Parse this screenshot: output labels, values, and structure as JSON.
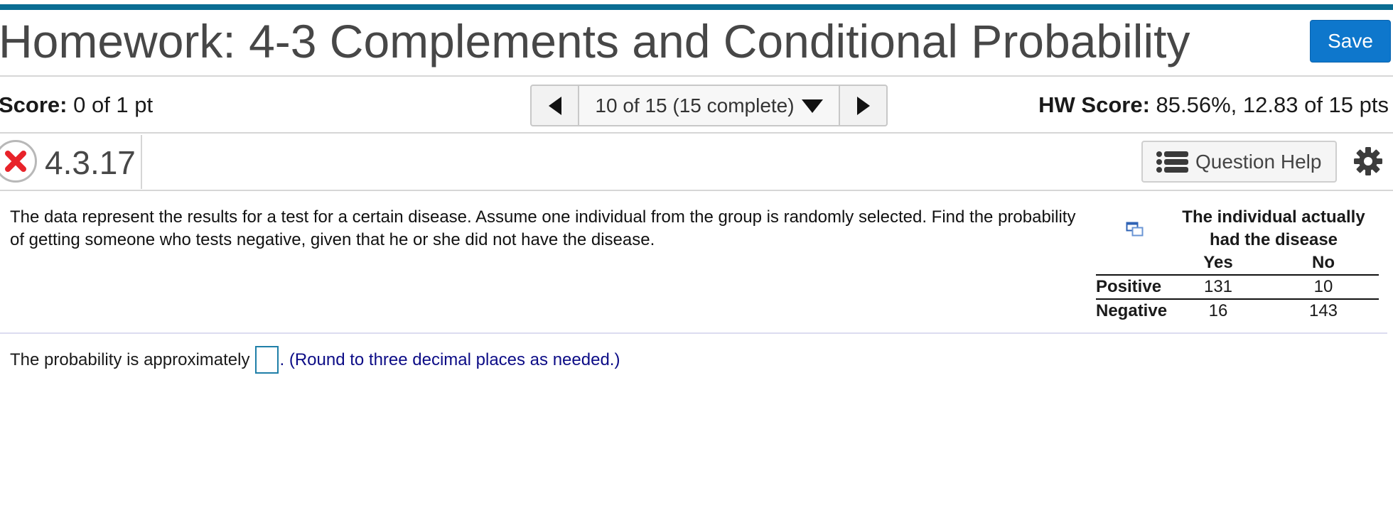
{
  "header": {
    "title": "Homework: 4-3 Complements and Conditional Probability",
    "save_label": "Save"
  },
  "score_bar": {
    "score_label": "Score:",
    "score_value": " 0 of 1 pt",
    "nav_text": "10 of 15 (15 complete)",
    "hw_score_label": "HW Score:",
    "hw_score_value": " 85.56%, 12.83 of 15 pts"
  },
  "question_header": {
    "number": "4.3.17",
    "help_label": "Question Help",
    "status": "incorrect"
  },
  "question": {
    "text": "The data represent the results for a test for a certain disease. Assume one individual from the group is randomly selected. Find the probability of getting someone who tests negative, given that he or she did not have the disease."
  },
  "data_table": {
    "heading": "The individual actually had the disease",
    "columns": [
      "Yes",
      "No"
    ],
    "rows": [
      {
        "label": "Positive",
        "values": [
          "131",
          "10"
        ]
      },
      {
        "label": "Negative",
        "values": [
          "16",
          "143"
        ]
      }
    ]
  },
  "answer": {
    "prefix": "The probability is approximately",
    "value": "",
    "hint": ". (Round to three decimal places as needed.)"
  },
  "colors": {
    "accent_bar": "#0a6d93",
    "save_button": "#0e77cc",
    "incorrect_mark": "#e8232a",
    "hint_text": "#0c0c86"
  }
}
